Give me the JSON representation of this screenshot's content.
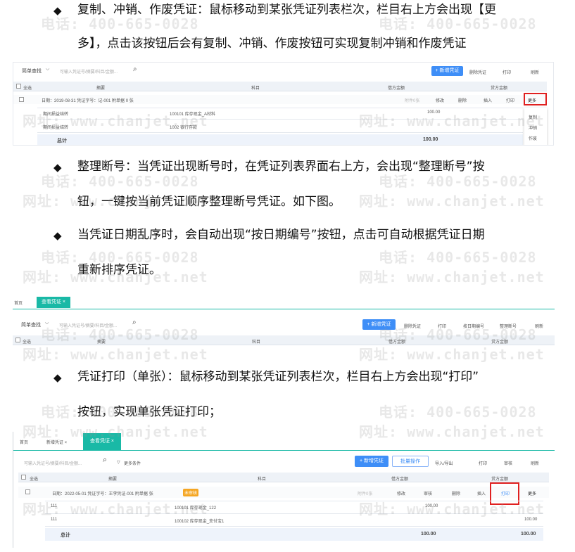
{
  "watermark": {
    "phone": "电话: 400-665-0028",
    "site": "网址: www.chanjet.net"
  },
  "bullets": {
    "copy": {
      "line1": "复制、冲销、作废凭证：鼠标移动到某张凭证列表栏次，栏目右上方会出现【更",
      "line2": "多】，点击该按钮后会有复制、冲销、作废按钮可实现复制冲销和作废凭证"
    },
    "renumber": {
      "line1": "整理断号：当凭证出现断号时，在凭证列表界面右上方，会出现“整理断号”按",
      "line2": "钮，一键按当前凭证顺序整理断号凭证。如下图。"
    },
    "bydate": {
      "line1": "当凭证日期乱序时，会自动出现“按日期编号”按钮，点击可自动根据凭证日期",
      "line2": "重新排序凭证。"
    },
    "print": {
      "line1": "凭证打印（单张）：鼠标移动到某张凭证列表栏次，栏目右上方会出现“打印”",
      "line2": "按钮，实现单张凭证打印；"
    }
  },
  "shot1": {
    "filter": "简单查找",
    "search_placeholder": "可输入凭证号/摘要/科目/金额...",
    "new_voucher": "+ 新增凭证",
    "delete_voucher": "删除凭证",
    "print": "打印",
    "refresh": "刷新",
    "headers": {
      "select_all": "全选",
      "summary": "摘要",
      "subject": "科目",
      "debit": "借方金额",
      "credit": "贷方金额"
    },
    "voucher_info": "日期：2019-08-31   凭证字号：记-001   附单据 0 张",
    "row_actions": {
      "attach": "附件0张",
      "edit": "修改",
      "delete": "删除",
      "insert": "插入",
      "print": "打印",
      "more": "更多"
    },
    "rows": [
      {
        "summary": "期间损益结转",
        "subject": "100101 库存现金_A材料",
        "debit": "100.00",
        "credit": ""
      },
      {
        "summary": "期间损益结转",
        "subject": "1002 银行存款",
        "debit": "",
        "credit": ""
      }
    ],
    "total_label": "总计",
    "total_debit": "100.00",
    "total_credit": "",
    "more_menu": [
      "复制",
      "冲销",
      "作废"
    ]
  },
  "shot2": {
    "home_tab": "首页",
    "active_tab": "查看凭证 ×",
    "filter": "简单查找",
    "search_placeholder": "可输入凭证号/摘要/科目/金额...",
    "new_voucher": "+ 新增凭证",
    "delete_voucher": "删除凭证",
    "print": "打印",
    "by_date": "按日期编号",
    "renumber": "整理断号",
    "refresh": "刷新",
    "headers": {
      "select_all": "全选",
      "summary": "摘要",
      "subject": "科目",
      "debit": "借方金额",
      "credit": "贷方金额"
    }
  },
  "shot3": {
    "home_tab": "首页",
    "tab_new": "新增凭证 ×",
    "active_tab": "查看凭证 ×",
    "search_placeholder": "可输入凭证号/摘要/科目/金额...",
    "more_conditions": "更多条件",
    "new_voucher": "+ 新增凭证",
    "batch": "批量操作",
    "import_export": "导入/导出",
    "print": "打印",
    "audit": "审核",
    "refresh": "刷新",
    "headers": {
      "select_all": "全选",
      "summary": "摘要",
      "subject": "科目",
      "debit": "借方金额",
      "credit": "贷方金额"
    },
    "voucher_info": "日期：2022-05-01   凭证字号：王李凭证-001   附单据 张",
    "status_tag": "未审核",
    "row_actions": {
      "attach": "附件0张",
      "edit": "修改",
      "audit": "审核",
      "delete": "删除",
      "insert": "插入",
      "print": "打印",
      "more": "更多"
    },
    "rows": [
      {
        "summary": "111",
        "subject": "100101 库存现金_122",
        "debit": "100.00",
        "credit": ""
      },
      {
        "summary": "111",
        "subject": "100102 库存现金_支付宝1",
        "debit": "",
        "credit": "100.00"
      }
    ],
    "total_label": "总计",
    "total_debit": "100.00",
    "total_credit": "100.00"
  }
}
